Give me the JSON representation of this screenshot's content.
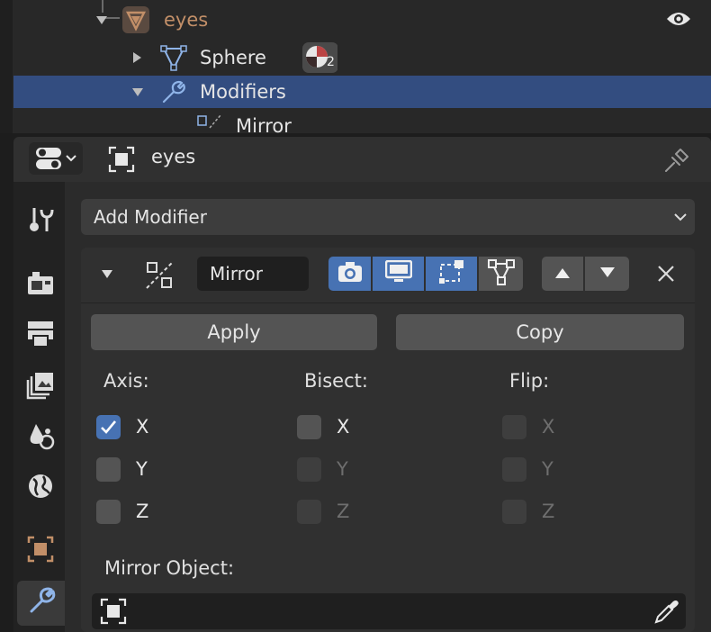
{
  "outliner": {
    "rows": [
      {
        "label": "eyes",
        "icon": "mesh-object-icon"
      },
      {
        "label": "Sphere",
        "icon": "mesh-data-icon",
        "badge_count": "2"
      },
      {
        "label": "Modifiers",
        "icon": "wrench-icon"
      },
      {
        "label": "Mirror",
        "icon": "mirror-modifier-icon"
      }
    ]
  },
  "properties": {
    "object_name": "eyes",
    "add_modifier_label": "Add Modifier",
    "modifier": {
      "name": "Mirror",
      "apply_label": "Apply",
      "copy_label": "Copy",
      "axis_label": "Axis:",
      "bisect_label": "Bisect:",
      "flip_label": "Flip:",
      "axis": [
        {
          "label": "X",
          "checked": true
        },
        {
          "label": "Y",
          "checked": false
        },
        {
          "label": "Z",
          "checked": false
        }
      ],
      "bisect": [
        {
          "label": "X",
          "enabled": true
        },
        {
          "label": "Y",
          "enabled": false
        },
        {
          "label": "Z",
          "enabled": false
        }
      ],
      "flip": [
        {
          "label": "X",
          "enabled": false
        },
        {
          "label": "Y",
          "enabled": false
        },
        {
          "label": "Z",
          "enabled": false
        }
      ],
      "mirror_object_label": "Mirror Object:",
      "mirror_object_value": ""
    }
  },
  "colors": {
    "accent": "#4772b3",
    "selected_row": "#334d80",
    "object_orange": "#c28f68"
  }
}
